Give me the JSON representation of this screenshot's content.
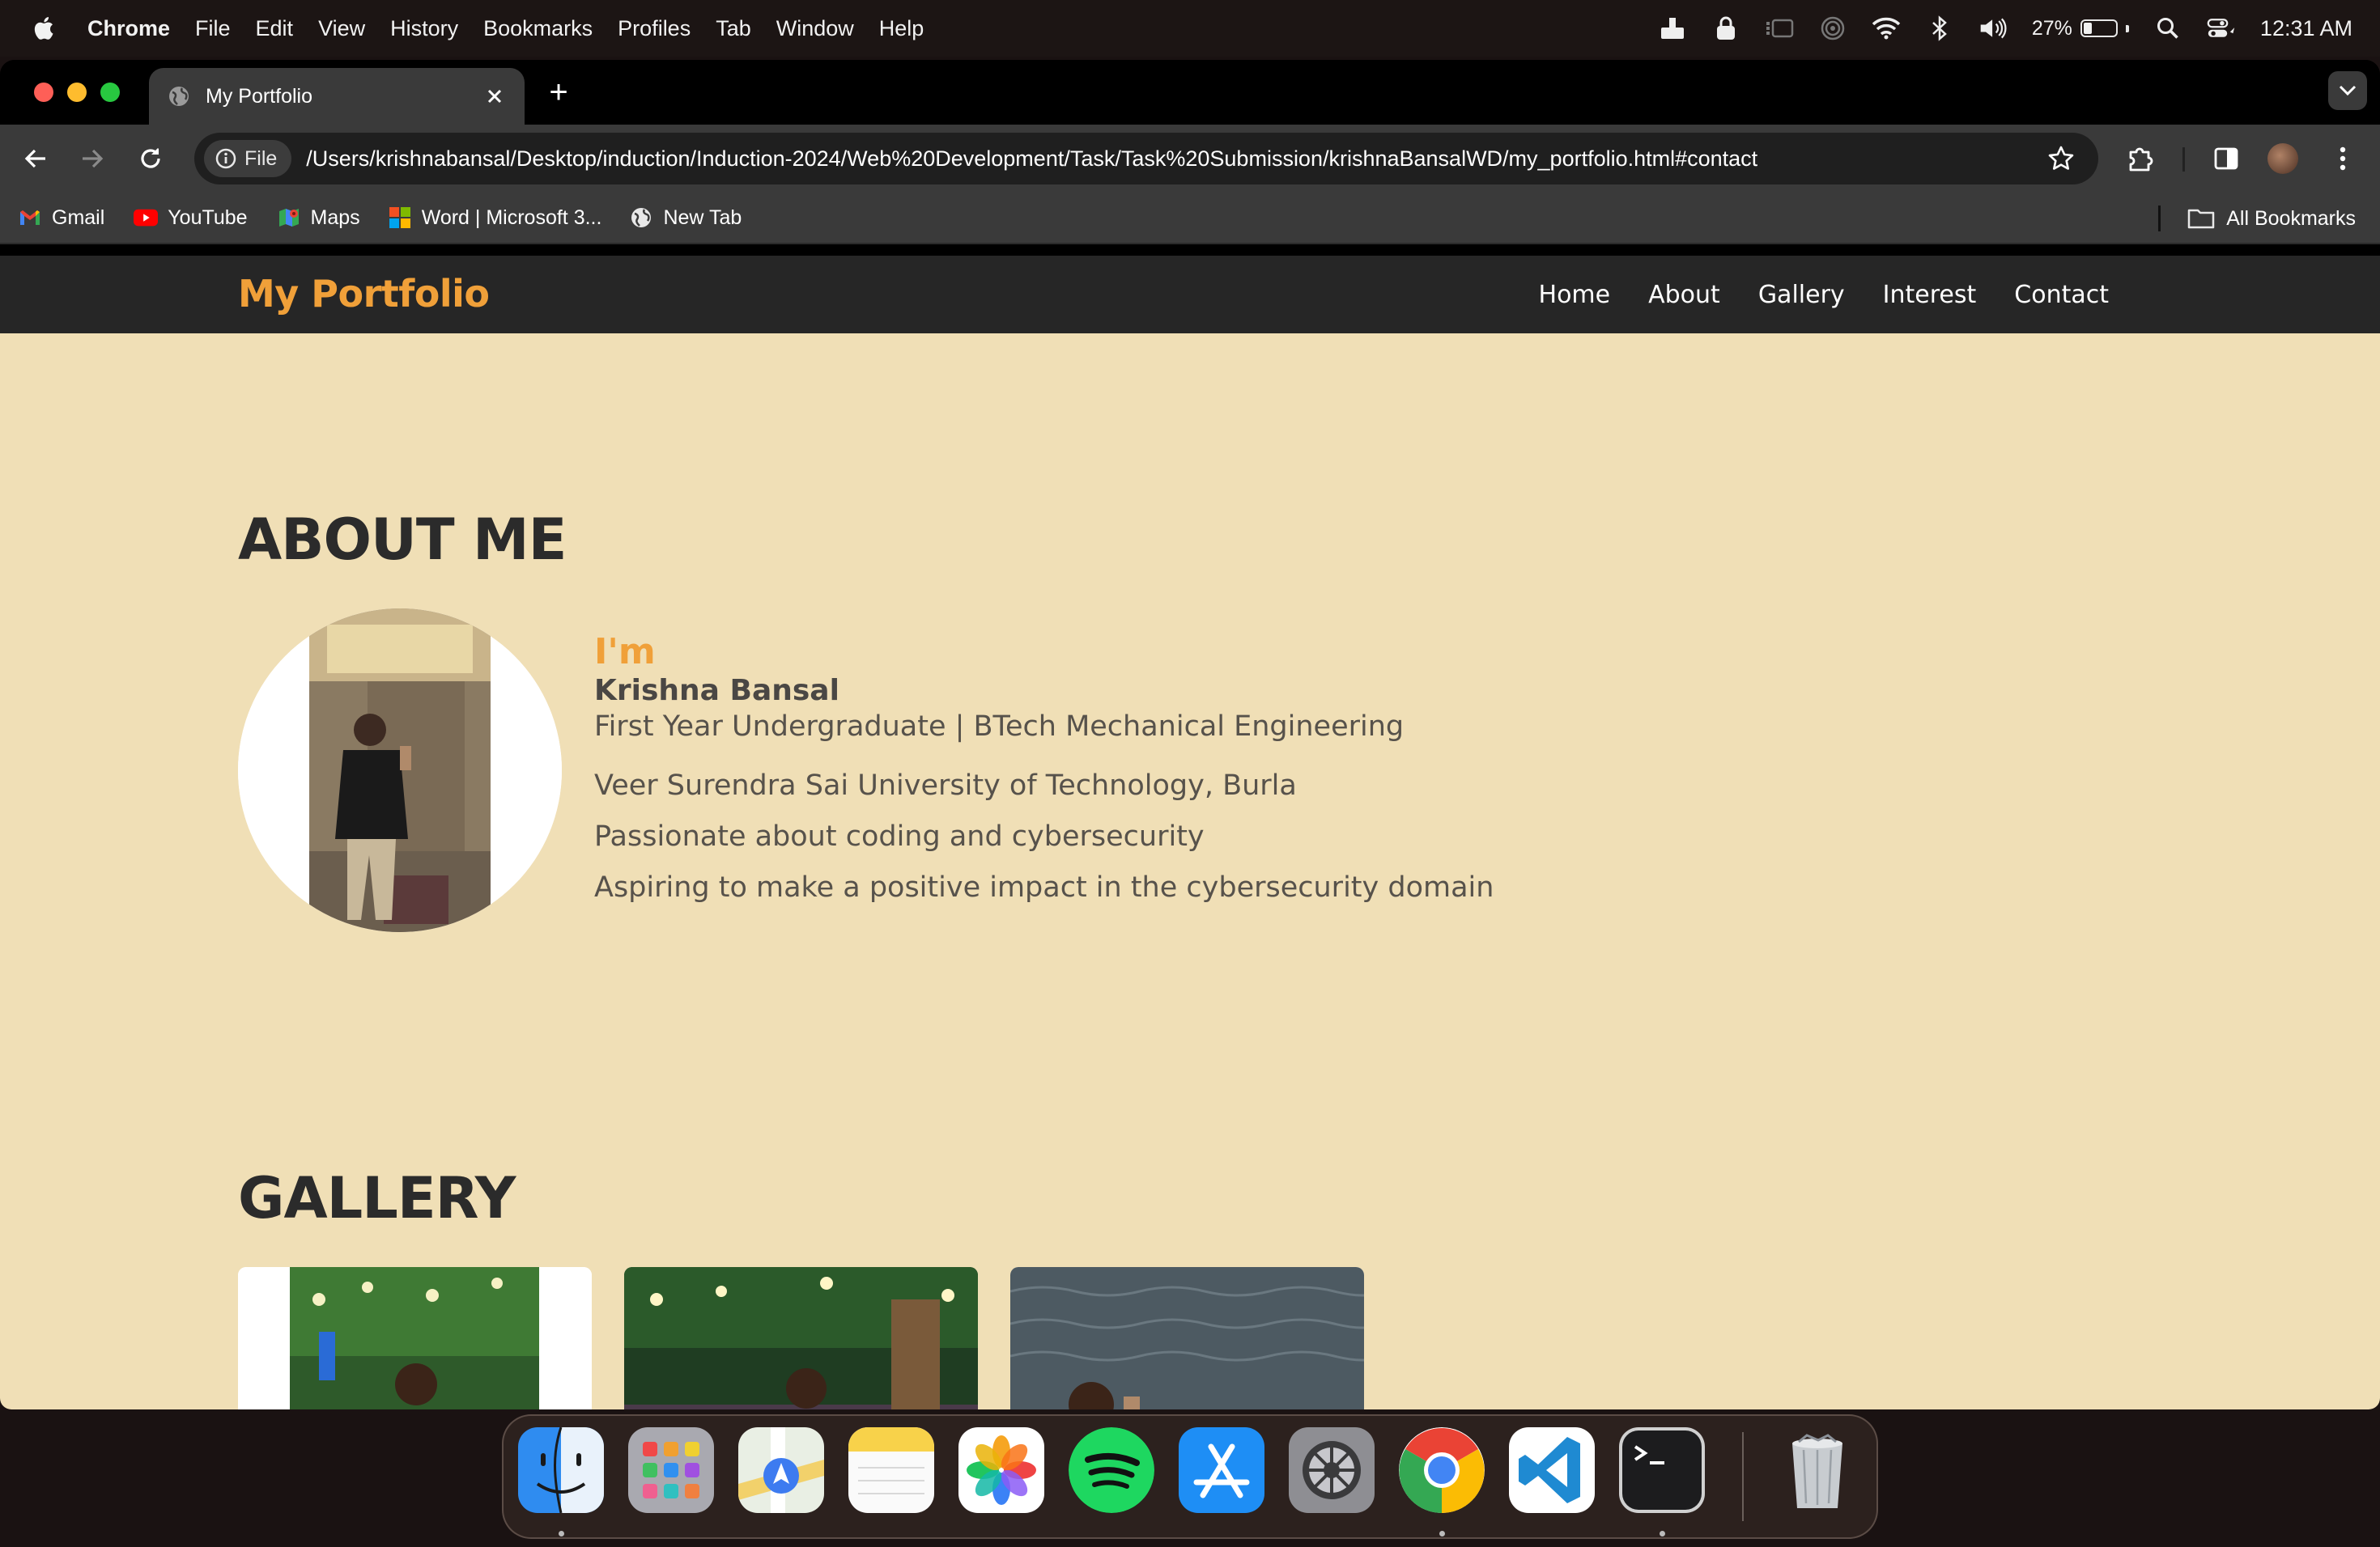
{
  "menubar": {
    "app_name": "Chrome",
    "menus": [
      "File",
      "Edit",
      "View",
      "History",
      "Bookmarks",
      "Profiles",
      "Tab",
      "Window",
      "Help"
    ],
    "battery_percent": "27%",
    "battery_level": 0.27,
    "time": "12:31 AM"
  },
  "browser": {
    "tab_title": "My Portfolio",
    "new_tab_symbol": "+",
    "scheme_chip": "File",
    "url": "/Users/krishnabansal/Desktop/induction/Induction-2024/Web%20Development/Task/Task%20Submission/krishnaBansalWD/my_portfolio.html#contact",
    "bookmarks": [
      {
        "label": "Gmail",
        "icon": "gmail-icon"
      },
      {
        "label": "YouTube",
        "icon": "youtube-icon"
      },
      {
        "label": "Maps",
        "icon": "maps-icon"
      },
      {
        "label": "Word | Microsoft 3...",
        "icon": "microsoft-icon"
      },
      {
        "label": "New Tab",
        "icon": "globe-icon"
      }
    ],
    "all_bookmarks": "All Bookmarks"
  },
  "site": {
    "brand": "My Portfolio",
    "nav": [
      "Home",
      "About",
      "Gallery",
      "Interest",
      "Contact"
    ],
    "about": {
      "heading": "ABOUT ME",
      "intro": "I'm",
      "name": "Krishna Bansal",
      "lines": [
        "First Year Undergraduate | BTech Mechanical Engineering",
        "Veer Surendra Sai University of Technology, Burla",
        "Passionate about coding and cybersecurity",
        "Aspiring to make a positive impact in the cybersecurity domain"
      ]
    },
    "gallery": {
      "heading": "GALLERY"
    }
  },
  "colors": {
    "page_bg": "#f0dfb6",
    "nav_bg": "#262626",
    "accent": "#f0a039",
    "heading": "#2b2b2b"
  },
  "dock": [
    "finder-icon",
    "launchpad-icon",
    "maps-app-icon",
    "notes-icon",
    "photos-icon",
    "spotify-icon",
    "app-store-icon",
    "system-settings-icon",
    "chrome-icon",
    "vscode-icon",
    "terminal-icon",
    "trash-icon"
  ]
}
